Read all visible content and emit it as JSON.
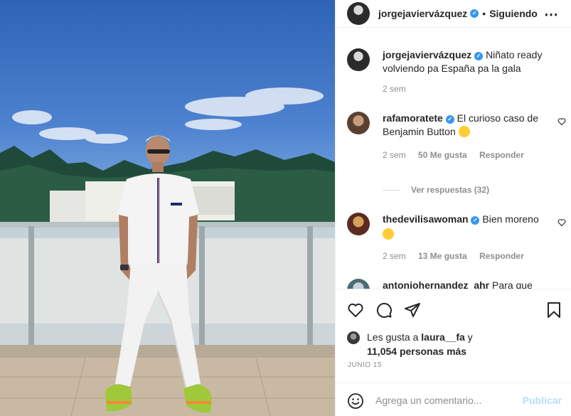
{
  "post": {
    "author": "jorgejaviervázquez",
    "follow_label": "Siguiendo",
    "more_label": "•••",
    "caption": "Niñato ready volviendo pa España pa la gala",
    "caption_time": "2 sem"
  },
  "header": {
    "author": "jorgejaviervázquez",
    "dot": "•",
    "follow": "Siguiendo"
  },
  "caption": {
    "author": "jorgejaviervázquez",
    "text": "Niñato ready volviendo pa España pa la gala",
    "time": "2 sem"
  },
  "comments": [
    {
      "author": "rafamoratete",
      "text": "El curioso caso de Benjamin Button",
      "time": "2 sem",
      "likes": "50 Me gusta",
      "reply": "Responder"
    },
    {
      "author": "thedevilisawoman",
      "text": "Bien moreno",
      "time": "2 sem",
      "likes": "13 Me gusta",
      "reply": "Responder"
    },
    {
      "author": "antoniohernandez_ahr",
      "text": "Para que"
    }
  ],
  "view_replies": "Ver respuestas (32)",
  "likes": {
    "prefix": "Les gusta a ",
    "user": "laura__fa",
    "middle": " y",
    "count": "11,054 personas más"
  },
  "date": "JUNIO 15",
  "compose": {
    "placeholder": "Agrega un comentario...",
    "publish": "Publicar"
  },
  "icons": [
    "heart-icon",
    "comment-icon",
    "share-icon",
    "bookmark-icon",
    "emoji-icon",
    "more-icon",
    "verified-icon"
  ],
  "colors": {
    "verified": "#3897f0",
    "publish_disabled": "#b2dffc",
    "muted": "#8e8e8e"
  }
}
